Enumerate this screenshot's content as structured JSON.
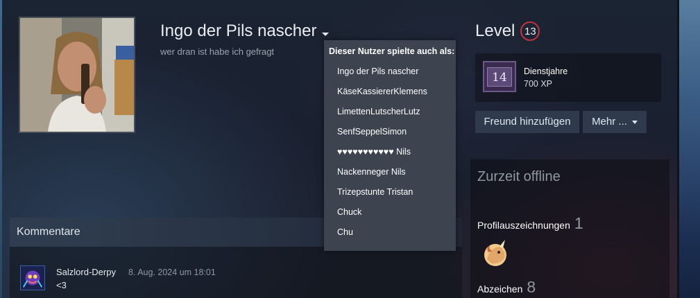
{
  "profile": {
    "persona_name": "Ingo der Pils nascher",
    "summary": "wer dran ist habe ich gefragt"
  },
  "dropdown": {
    "title": "Dieser Nutzer spielte auch als:",
    "names": [
      "Ingo der Pils nascher",
      "KäseKassiererKlemens",
      "LimettenLutscherLutz",
      "SenfSeppelSimon",
      "♥♥♥♥♥♥♥♥♥♥♥ Nils",
      "Nackenneger Nils",
      "Trizepstunte Tristan",
      "Chuck",
      "Chu"
    ]
  },
  "level": {
    "label": "Level",
    "value": "13",
    "badge_number": "14",
    "badge_name": "Dienstjahre",
    "badge_xp": "700 XP"
  },
  "actions": {
    "add_friend": "Freund hinzufügen",
    "more": "Mehr ..."
  },
  "sidebar": {
    "status": "Zurzeit offline",
    "awards_label": "Profilauszeichnungen",
    "awards_count": "1",
    "badges_label": "Abzeichen",
    "badges_count": "8"
  },
  "comments": {
    "title": "Kommentare",
    "items": [
      {
        "author": "Salzlord-Derpy",
        "time": "8. Aug. 2024 um 18:01",
        "text": "<3"
      }
    ]
  },
  "colors": {
    "level_ring": "#c4343e",
    "button_bg": "#2f3b4c",
    "dropdown_bg": "#3d4450"
  }
}
